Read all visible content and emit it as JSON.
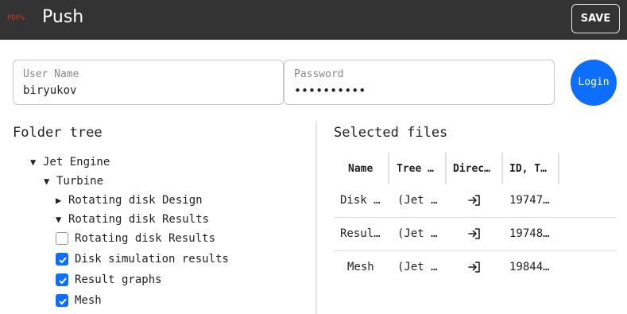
{
  "header": {
    "logo_text": "PDF%",
    "title": "Push",
    "save_label": "SAVE"
  },
  "login": {
    "user_label": "User Name",
    "user_value": "biryukov",
    "password_label": "Password",
    "password_value": "••••••••••",
    "login_label": "Login"
  },
  "folder_tree": {
    "title": "Folder tree",
    "nodes": [
      {
        "label": "Jet Engine",
        "caret": "▼"
      },
      {
        "label": "Turbine",
        "caret": "▼"
      },
      {
        "label": "Rotating disk Design",
        "caret": "▶"
      },
      {
        "label": "Rotating disk Results",
        "caret": "▼"
      }
    ],
    "files": [
      {
        "label": "Rotating disk Results",
        "checked": false
      },
      {
        "label": "Disk simulation results",
        "checked": true
      },
      {
        "label": "Result graphs",
        "checked": true
      },
      {
        "label": "Mesh",
        "checked": true
      }
    ]
  },
  "selected_files": {
    "title": "Selected files",
    "columns": [
      "Name",
      "Tree …",
      "Direc…",
      "ID, T…"
    ],
    "rows": [
      {
        "name": "Disk …",
        "tree": "(Jet …",
        "direction_icon": "login-arrow-icon",
        "id": "19747…"
      },
      {
        "name": "Resul…",
        "tree": "(Jet …",
        "direction_icon": "login-arrow-icon",
        "id": "19748…"
      },
      {
        "name": "Mesh",
        "tree": "(Jet …",
        "direction_icon": "login-arrow-icon",
        "id": "19844…"
      }
    ]
  },
  "colors": {
    "topbar": "#333333",
    "accent": "#0d6efd",
    "logo": "#c0392b"
  }
}
